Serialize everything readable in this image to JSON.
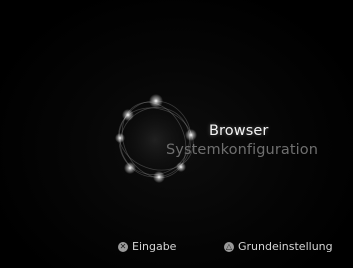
{
  "menu": {
    "items": [
      {
        "label": "Browser",
        "state": "selected"
      },
      {
        "label": "Systemkonfiguration",
        "state": "unselected"
      }
    ]
  },
  "hints": {
    "confirm": {
      "icon": "cross-button-icon",
      "glyph": "✕",
      "label": "Eingabe"
    },
    "settings": {
      "icon": "triangle-button-icon",
      "glyph": "△",
      "label": "Grundeinstellung"
    }
  },
  "colors": {
    "background": "#000000",
    "selected_text": "#f2f2f2",
    "unselected_text": "#6f6f6f",
    "hint_text": "#d6d6d6",
    "orb_glow": "#ffffff"
  }
}
